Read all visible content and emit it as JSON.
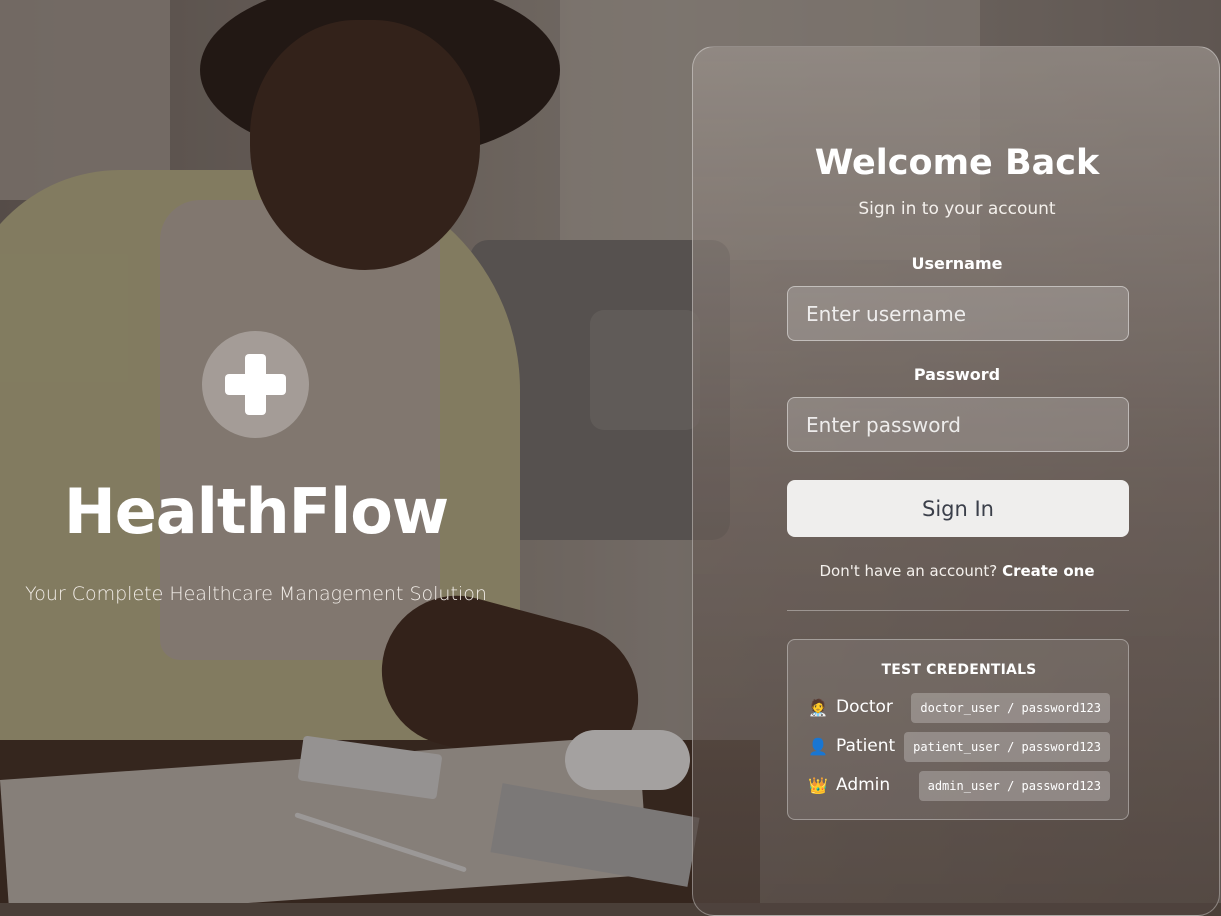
{
  "hero": {
    "title": "HealthFlow",
    "subtitle": "Your Complete Healthcare Management Solution",
    "logo_icon": "medical-cross-icon"
  },
  "login": {
    "title": "Welcome Back",
    "subtitle": "Sign in to your account",
    "username_label": "Username",
    "username_placeholder": "Enter username",
    "password_label": "Password",
    "password_placeholder": "Enter password",
    "submit_label": "Sign In",
    "signup_prompt": "Don't have an account?",
    "signup_link": "Create one"
  },
  "test_credentials": {
    "title": "TEST CREDENTIALS",
    "items": [
      {
        "icon": "doctor-icon",
        "glyph": "🧑‍⚕️",
        "role": "Doctor",
        "credentials": "doctor_user / password123"
      },
      {
        "icon": "patient-icon",
        "glyph": "👤",
        "role": "Patient",
        "credentials": "patient_user / password123"
      },
      {
        "icon": "crown-icon",
        "glyph": "👑",
        "role": "Admin",
        "credentials": "admin_user / password123"
      }
    ]
  }
}
